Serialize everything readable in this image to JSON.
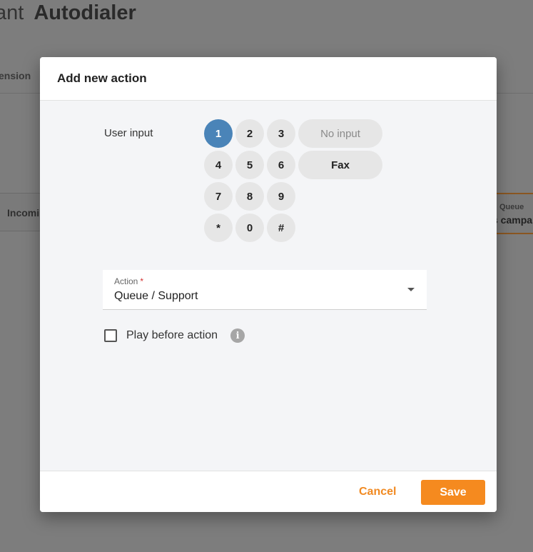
{
  "background": {
    "title_prefix": "ant",
    "title": "Autodialer",
    "tab_label": "ension",
    "left_node_label": "Incomi",
    "right_node_small": "Queue",
    "right_node_label": "s campa"
  },
  "modal": {
    "title": "Add new action",
    "user_input_label": "User input",
    "keys": [
      "1",
      "2",
      "3",
      "4",
      "5",
      "6",
      "7",
      "8",
      "9",
      "*",
      "0",
      "#"
    ],
    "selected_key": "1",
    "no_input_label": "No input",
    "fax_label": "Fax",
    "action": {
      "label": "Action",
      "required_mark": "*",
      "value": "Queue / Support"
    },
    "play_before_action": {
      "label": "Play before action",
      "checked": false
    },
    "info_icon": "i",
    "cancel_label": "Cancel",
    "save_label": "Save"
  },
  "colors": {
    "accent": "#f58a1f",
    "selected_key": "#4a84b8"
  }
}
